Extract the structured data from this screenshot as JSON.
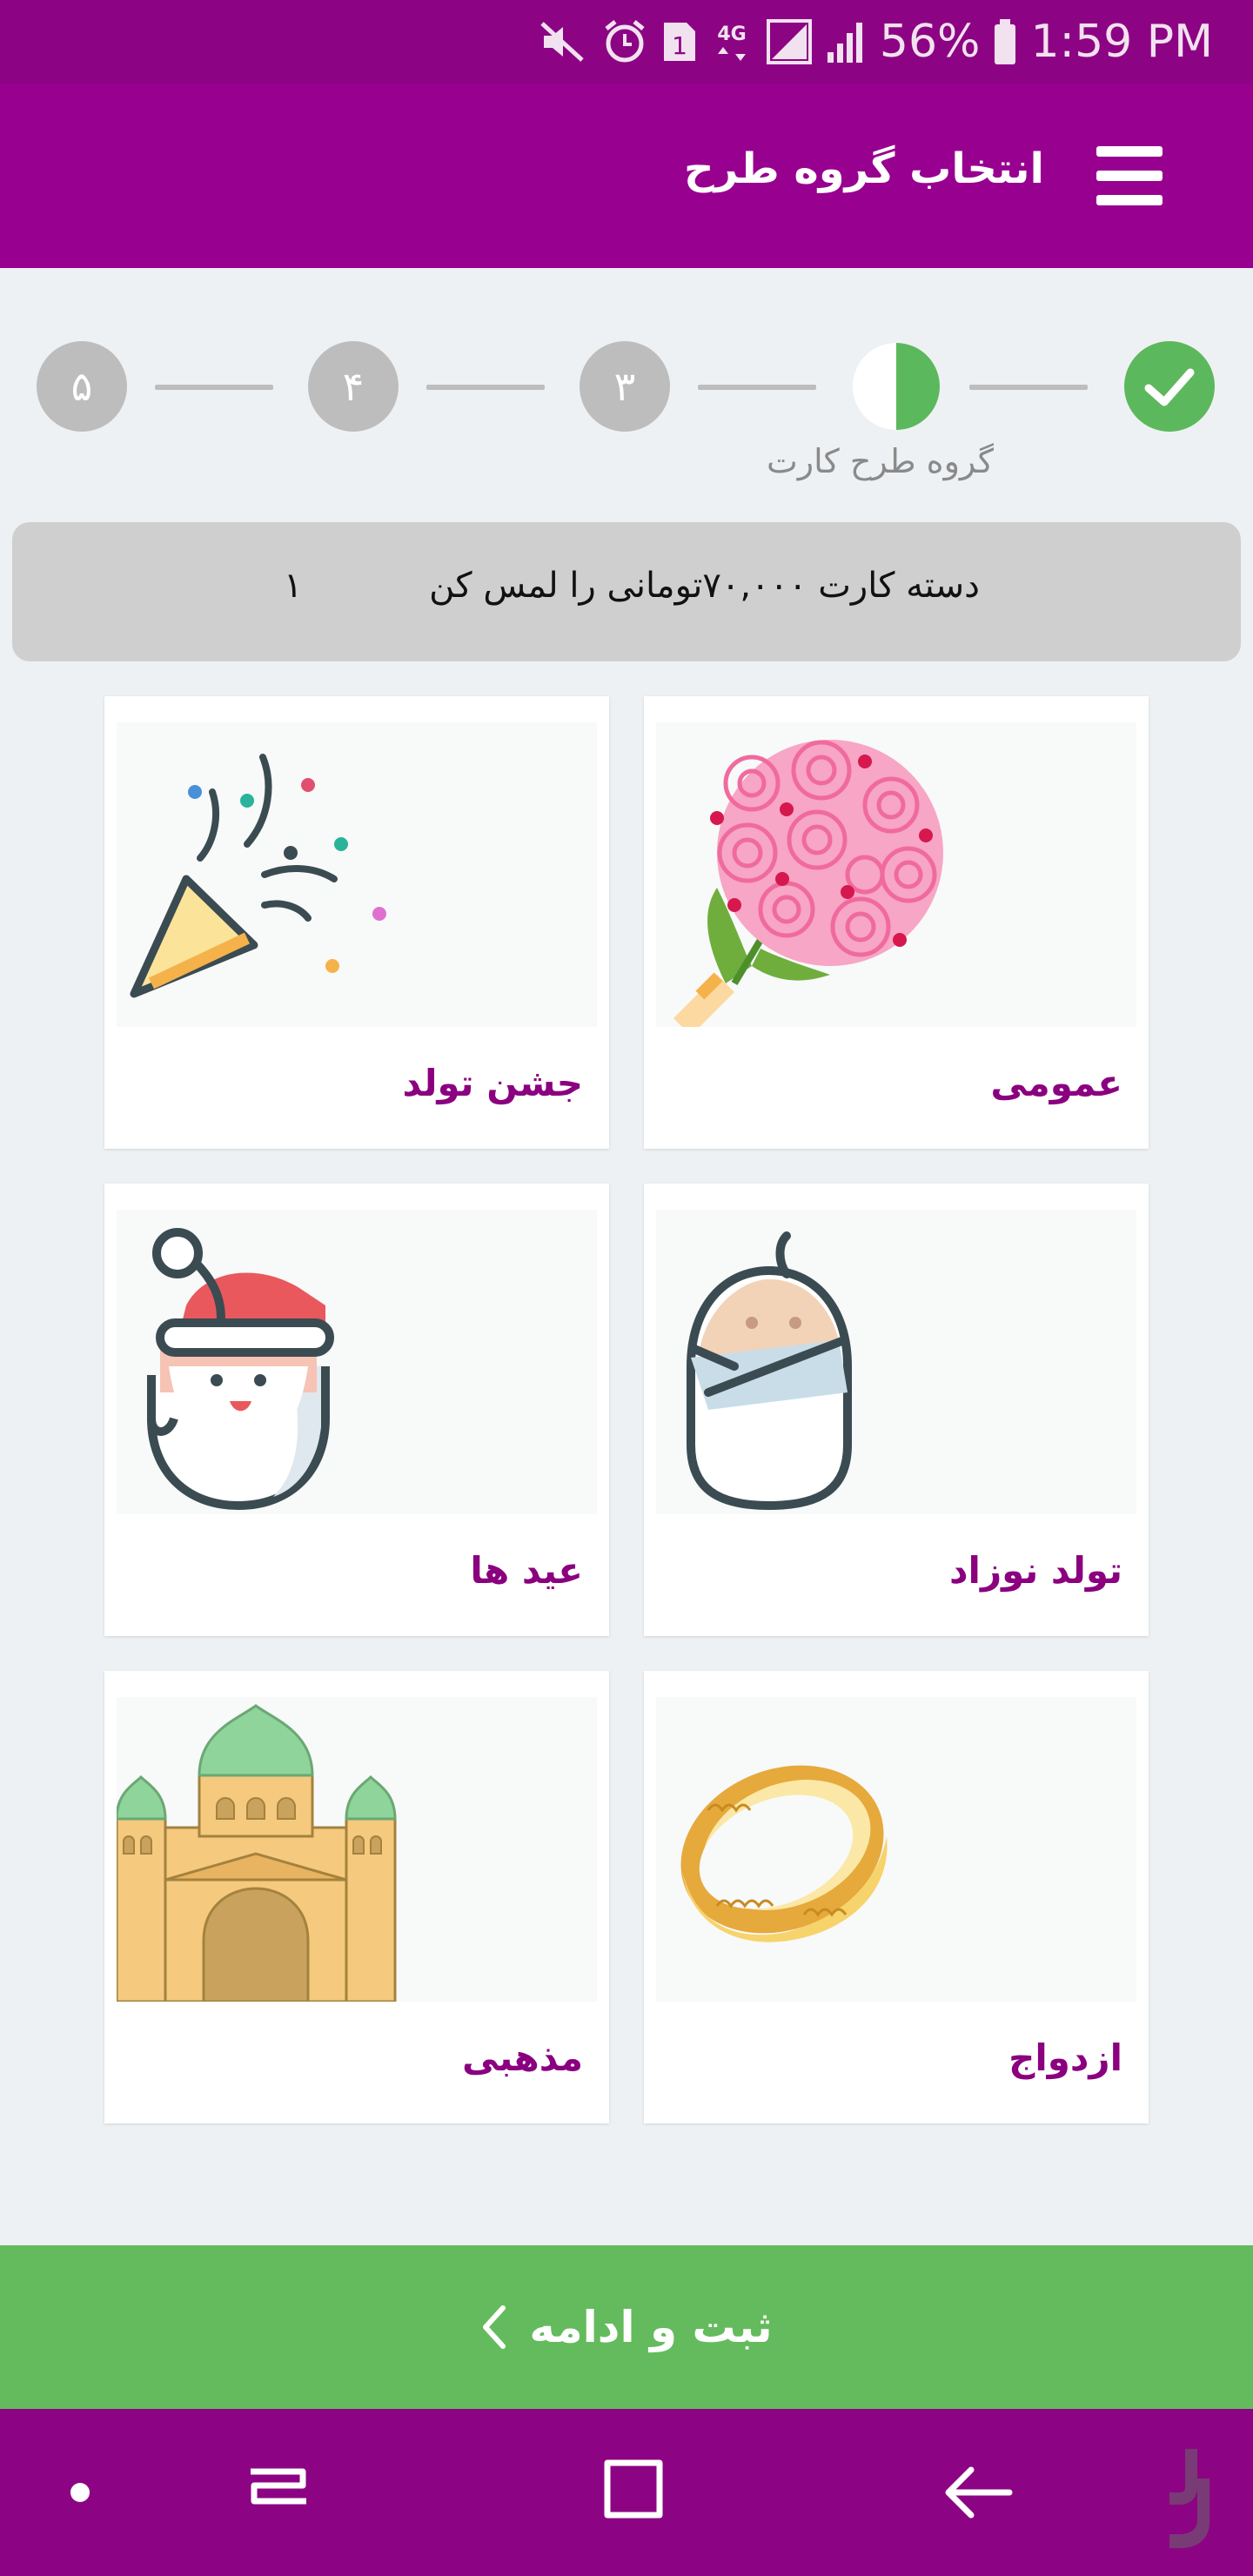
{
  "status_bar": {
    "signal_label": "4G",
    "sim_badge": "1",
    "battery_percent": "56%",
    "time": "1:59 PM",
    "icons": [
      "mute-icon",
      "alarm-icon",
      "sim-icon",
      "network-4g-icon",
      "signal-icon",
      "signal-icon",
      "battery-icon"
    ]
  },
  "app_bar": {
    "title": "انتخاب گروه طرح",
    "menu_icon": "hamburger-menu-icon"
  },
  "stepper": {
    "steps": [
      {
        "label": "",
        "state": "done"
      },
      {
        "label": "",
        "state": "current"
      },
      {
        "label": "۳",
        "state": "pending"
      },
      {
        "label": "۴",
        "state": "pending"
      },
      {
        "label": "۵",
        "state": "pending"
      }
    ],
    "current_label": "گروه طرح کارت"
  },
  "banner": {
    "text": "دسته کارت ۷۰,۰۰۰تومانی را لمس کن",
    "count": "۱"
  },
  "categories": [
    {
      "label": "عمومی",
      "icon": "bouquet-icon"
    },
    {
      "label": "جشن تولد",
      "icon": "party-popper-icon"
    },
    {
      "label": "تولد نوزاد",
      "icon": "swaddled-baby-icon"
    },
    {
      "label": "عید ها",
      "icon": "santa-icon"
    },
    {
      "label": "ازدواج",
      "icon": "wedding-ring-icon"
    },
    {
      "label": "مذهبی",
      "icon": "mosque-icon"
    }
  ],
  "continue_button": {
    "label": "ثبت و ادامه"
  },
  "colors": {
    "status_bar": "#8c0484",
    "app_bar": "#980090",
    "accent_green": "#64bb5d",
    "card_label": "#8a007f"
  }
}
